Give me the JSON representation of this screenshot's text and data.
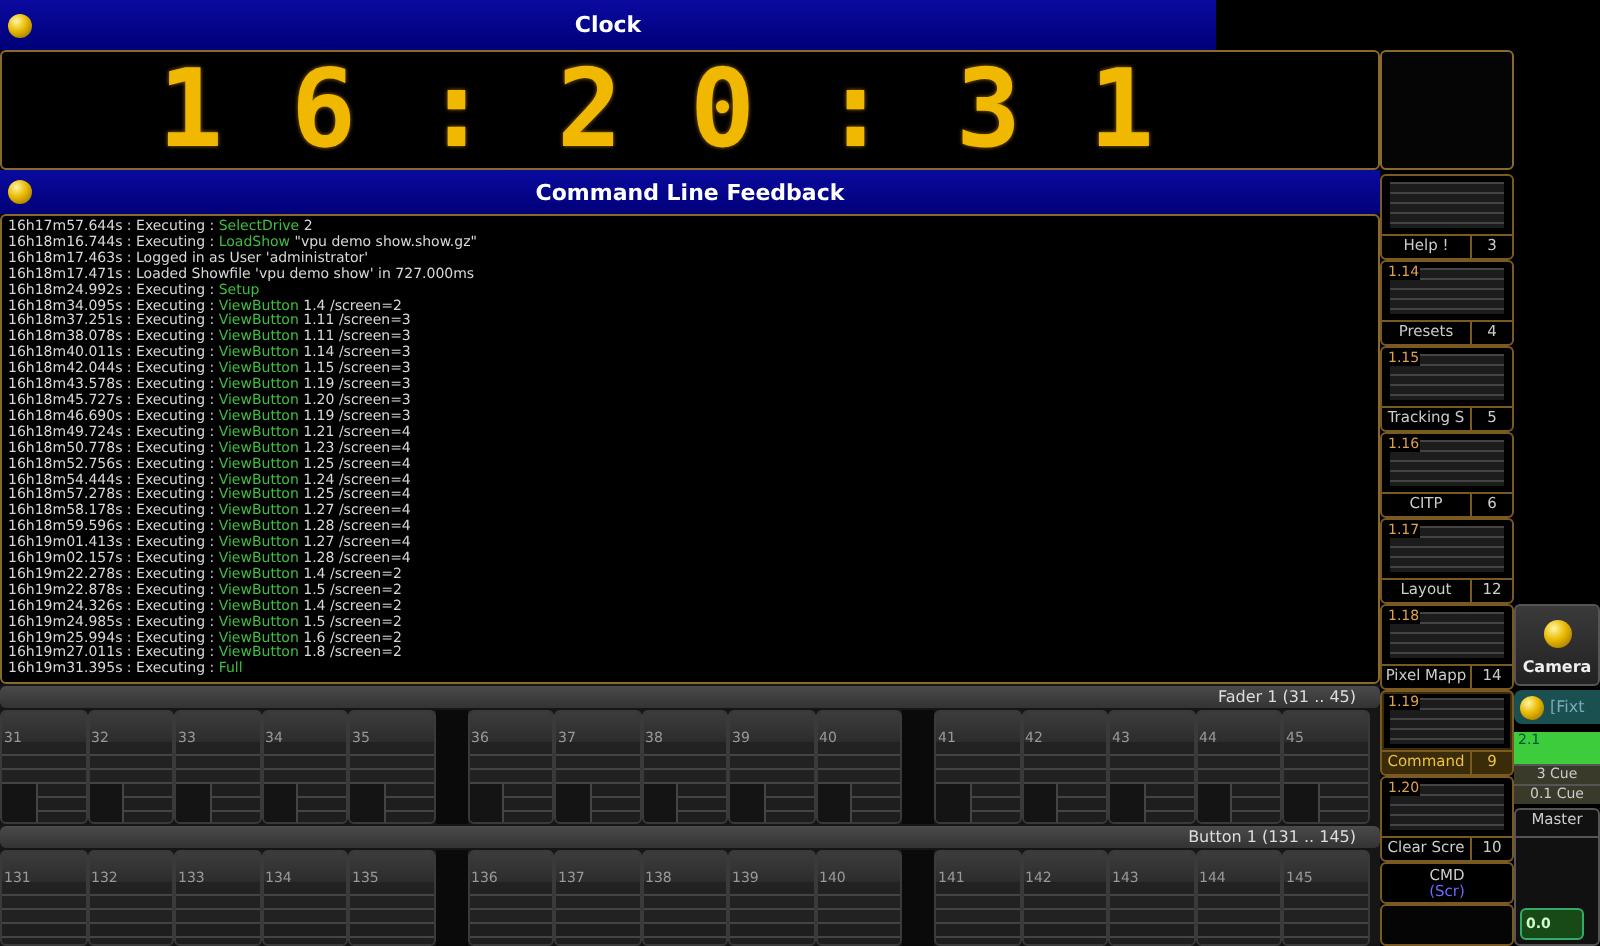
{
  "clock": {
    "title": "Clock",
    "time": "16:20:31"
  },
  "feedback": {
    "title": "Command Line Feedback",
    "lines": [
      {
        "prefix": "16h17m57.644s : Executing : ",
        "command": "SelectDrive",
        "args": " 2"
      },
      {
        "prefix": "16h18m16.744s : Executing : ",
        "command": "LoadShow",
        "args": " \"vpu demo show.show.gz\""
      },
      {
        "prefix": "16h18m17.463s : Logged in as User 'administrator'"
      },
      {
        "prefix": "16h18m17.471s : Loaded Showfile 'vpu demo show' in 727.000ms"
      },
      {
        "prefix": "16h18m24.992s : Executing : ",
        "command": "Setup"
      },
      {
        "prefix": "16h18m34.095s : Executing : ",
        "command": "ViewButton",
        "args": " 1.4 /screen=2"
      },
      {
        "prefix": "16h18m37.251s : Executing : ",
        "command": "ViewButton",
        "args": " 1.11 /screen=3"
      },
      {
        "prefix": "16h18m38.078s : Executing : ",
        "command": "ViewButton",
        "args": " 1.11 /screen=3"
      },
      {
        "prefix": "16h18m40.011s : Executing : ",
        "command": "ViewButton",
        "args": " 1.14 /screen=3"
      },
      {
        "prefix": "16h18m42.044s : Executing : ",
        "command": "ViewButton",
        "args": " 1.15 /screen=3"
      },
      {
        "prefix": "16h18m43.578s : Executing : ",
        "command": "ViewButton",
        "args": " 1.19 /screen=3"
      },
      {
        "prefix": "16h18m45.727s : Executing : ",
        "command": "ViewButton",
        "args": " 1.20 /screen=3"
      },
      {
        "prefix": "16h18m46.690s : Executing : ",
        "command": "ViewButton",
        "args": " 1.19 /screen=3"
      },
      {
        "prefix": "16h18m49.724s : Executing : ",
        "command": "ViewButton",
        "args": " 1.21 /screen=4"
      },
      {
        "prefix": "16h18m50.778s : Executing : ",
        "command": "ViewButton",
        "args": " 1.23 /screen=4"
      },
      {
        "prefix": "16h18m52.756s : Executing : ",
        "command": "ViewButton",
        "args": " 1.25 /screen=4"
      },
      {
        "prefix": "16h18m54.444s : Executing : ",
        "command": "ViewButton",
        "args": " 1.24 /screen=4"
      },
      {
        "prefix": "16h18m57.278s : Executing : ",
        "command": "ViewButton",
        "args": " 1.25 /screen=4"
      },
      {
        "prefix": "16h18m58.178s : Executing : ",
        "command": "ViewButton",
        "args": " 1.27 /screen=4"
      },
      {
        "prefix": "16h18m59.596s : Executing : ",
        "command": "ViewButton",
        "args": " 1.28 /screen=4"
      },
      {
        "prefix": "16h19m01.413s : Executing : ",
        "command": "ViewButton",
        "args": " 1.27 /screen=4"
      },
      {
        "prefix": "16h19m02.157s : Executing : ",
        "command": "ViewButton",
        "args": " 1.28 /screen=4"
      },
      {
        "prefix": "16h19m22.278s : Executing : ",
        "command": "ViewButton",
        "args": " 1.4 /screen=2"
      },
      {
        "prefix": "16h19m22.878s : Executing : ",
        "command": "ViewButton",
        "args": " 1.5 /screen=2"
      },
      {
        "prefix": "16h19m24.326s : Executing : ",
        "command": "ViewButton",
        "args": " 1.4 /screen=2"
      },
      {
        "prefix": "16h19m24.985s : Executing : ",
        "command": "ViewButton",
        "args": " 1.5 /screen=2"
      },
      {
        "prefix": "16h19m25.994s : Executing : ",
        "command": "ViewButton",
        "args": " 1.6 /screen=2"
      },
      {
        "prefix": "16h19m27.011s : Executing : ",
        "command": "ViewButton",
        "args": " 1.8 /screen=2"
      },
      {
        "prefix": "16h19m31.395s : Executing : ",
        "command": "Full"
      }
    ]
  },
  "faders": {
    "title": "Fader  1 (31 .. 45)",
    "slots": [
      {
        "number": "31"
      },
      {
        "number": "32"
      },
      {
        "number": "33"
      },
      {
        "number": "34"
      },
      {
        "number": "35"
      },
      {
        "kind": "gap"
      },
      {
        "number": "36"
      },
      {
        "number": "37"
      },
      {
        "number": "38"
      },
      {
        "number": "39"
      },
      {
        "number": "40"
      },
      {
        "kind": "gap"
      },
      {
        "number": "41"
      },
      {
        "number": "42"
      },
      {
        "number": "43"
      },
      {
        "number": "44"
      },
      {
        "number": "45"
      }
    ]
  },
  "buttons": {
    "title": "Button  1 (131 .. 145)",
    "slots": [
      {
        "number": "131"
      },
      {
        "number": "132"
      },
      {
        "number": "133"
      },
      {
        "number": "134"
      },
      {
        "number": "135"
      },
      {
        "kind": "gap"
      },
      {
        "number": "136"
      },
      {
        "number": "137"
      },
      {
        "number": "138"
      },
      {
        "number": "139"
      },
      {
        "number": "140"
      },
      {
        "kind": "gap"
      },
      {
        "number": "141"
      },
      {
        "number": "142"
      },
      {
        "number": "143"
      },
      {
        "number": "144"
      },
      {
        "number": "145"
      }
    ]
  },
  "view_buttons": [
    {
      "label": "Help !",
      "number": "3",
      "selected": false
    },
    {
      "index": "1.14",
      "label": "Presets",
      "number": "4",
      "selected": false
    },
    {
      "index": "1.15",
      "label": "Tracking S",
      "number": "5",
      "selected": false
    },
    {
      "index": "1.16",
      "label": "CITP",
      "number": "6",
      "selected": false
    },
    {
      "index": "1.17",
      "label": "Layout",
      "number": "12",
      "selected": false
    },
    {
      "index": "1.18",
      "label": "Pixel Mapp",
      "number": "14",
      "selected": false
    },
    {
      "index": "1.19",
      "label": "Command",
      "number": "9",
      "selected": true
    },
    {
      "index": "1.20",
      "label": "Clear Scre",
      "number": "10",
      "selected": false
    }
  ],
  "cmd_button": {
    "label": "CMD",
    "sub": "(Scr)"
  },
  "camera_button": {
    "label": "Camera"
  },
  "fixture_bar": {
    "label": "[Fixt"
  },
  "executor": {
    "number": "2.1",
    "cues": [
      "3 Cue",
      "0.1 Cue"
    ]
  },
  "master": {
    "title": "Master",
    "value": "0.0"
  }
}
